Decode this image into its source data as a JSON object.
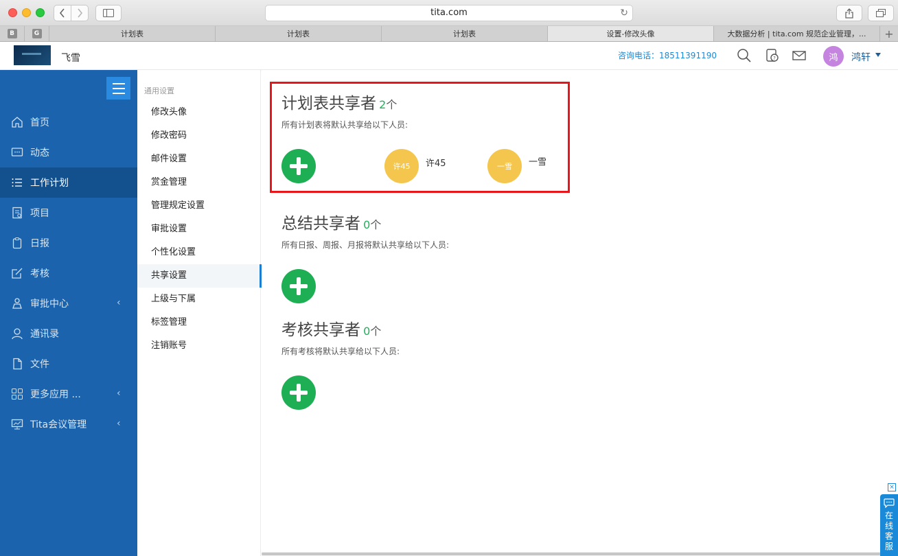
{
  "browser": {
    "url": "tita.com",
    "pinned_tabs": [
      "B",
      "G"
    ],
    "tabs": [
      {
        "label": "计划表",
        "active": false
      },
      {
        "label": "计划表",
        "active": false
      },
      {
        "label": "计划表",
        "active": false
      },
      {
        "label": "设置-修改头像",
        "active": true
      },
      {
        "label": "大数据分析 | tita.com 规范企业管理，...",
        "active": false
      }
    ],
    "new_tab_label": "+"
  },
  "header": {
    "company_name": "飞雪",
    "phone": "咨询电话：18511391190",
    "user_initial": "鸿",
    "user_name": "鸿轩",
    "icons": [
      "search-icon",
      "help-icon",
      "mail-icon"
    ]
  },
  "sidebar": {
    "items": [
      {
        "label": "首页",
        "icon": "home-icon",
        "active": false,
        "has_chevron": false
      },
      {
        "label": "动态",
        "icon": "chat-icon",
        "active": false,
        "has_chevron": false
      },
      {
        "label": "工作计划",
        "icon": "list-icon",
        "active": true,
        "has_chevron": false
      },
      {
        "label": "项目",
        "icon": "project-icon",
        "active": false,
        "has_chevron": false
      },
      {
        "label": "日报",
        "icon": "clipboard-icon",
        "active": false,
        "has_chevron": false
      },
      {
        "label": "考核",
        "icon": "edit-icon",
        "active": false,
        "has_chevron": false
      },
      {
        "label": "审批中心",
        "icon": "approval-icon",
        "active": false,
        "has_chevron": true
      },
      {
        "label": "通讯录",
        "icon": "person-icon",
        "active": false,
        "has_chevron": false
      },
      {
        "label": "文件",
        "icon": "file-icon",
        "active": false,
        "has_chevron": false
      },
      {
        "label": "更多应用 ...",
        "icon": "grid-icon",
        "active": false,
        "has_chevron": true
      },
      {
        "label": "Tita会议管理",
        "icon": "meeting-icon",
        "active": false,
        "has_chevron": true
      }
    ]
  },
  "settings_nav": {
    "group_label": "通用设置",
    "items": [
      {
        "label": "修改头像",
        "active": false
      },
      {
        "label": "修改密码",
        "active": false
      },
      {
        "label": "邮件设置",
        "active": false
      },
      {
        "label": "赏金管理",
        "active": false
      },
      {
        "label": "管理规定设置",
        "active": false
      },
      {
        "label": "审批设置",
        "active": false
      },
      {
        "label": "个性化设置",
        "active": false
      },
      {
        "label": "共享设置",
        "active": true
      },
      {
        "label": "上级与下属",
        "active": false
      },
      {
        "label": "标签管理",
        "active": false
      },
      {
        "label": "注销账号",
        "active": false
      }
    ]
  },
  "main": {
    "sections": [
      {
        "title": "计划表共享者",
        "count": "2",
        "unit": "个",
        "description": "所有计划表将默认共享给以下人员:",
        "members": [
          {
            "avatar_text": "许45",
            "name": "许45"
          },
          {
            "avatar_text": "一雪",
            "name": "一雪"
          }
        ]
      },
      {
        "title": "总结共享者",
        "count": "0",
        "unit": "个",
        "description": "所有日报、周报、月报将默认共享给以下人员:",
        "members": []
      },
      {
        "title": "考核共享者",
        "count": "0",
        "unit": "个",
        "description": "所有考核将默认共享给以下人员:",
        "members": []
      }
    ]
  },
  "service_widget": {
    "label": "在线客服",
    "close": "×"
  },
  "colors": {
    "sidebar_bg": "#1b63ac",
    "sidebar_active": "#13508e",
    "accent_green": "#1eae54",
    "count_green": "#1fb15a",
    "avatar_yellow": "#f4c64e",
    "highlight_red": "#e8161b",
    "link_blue": "#1a8ad8"
  }
}
